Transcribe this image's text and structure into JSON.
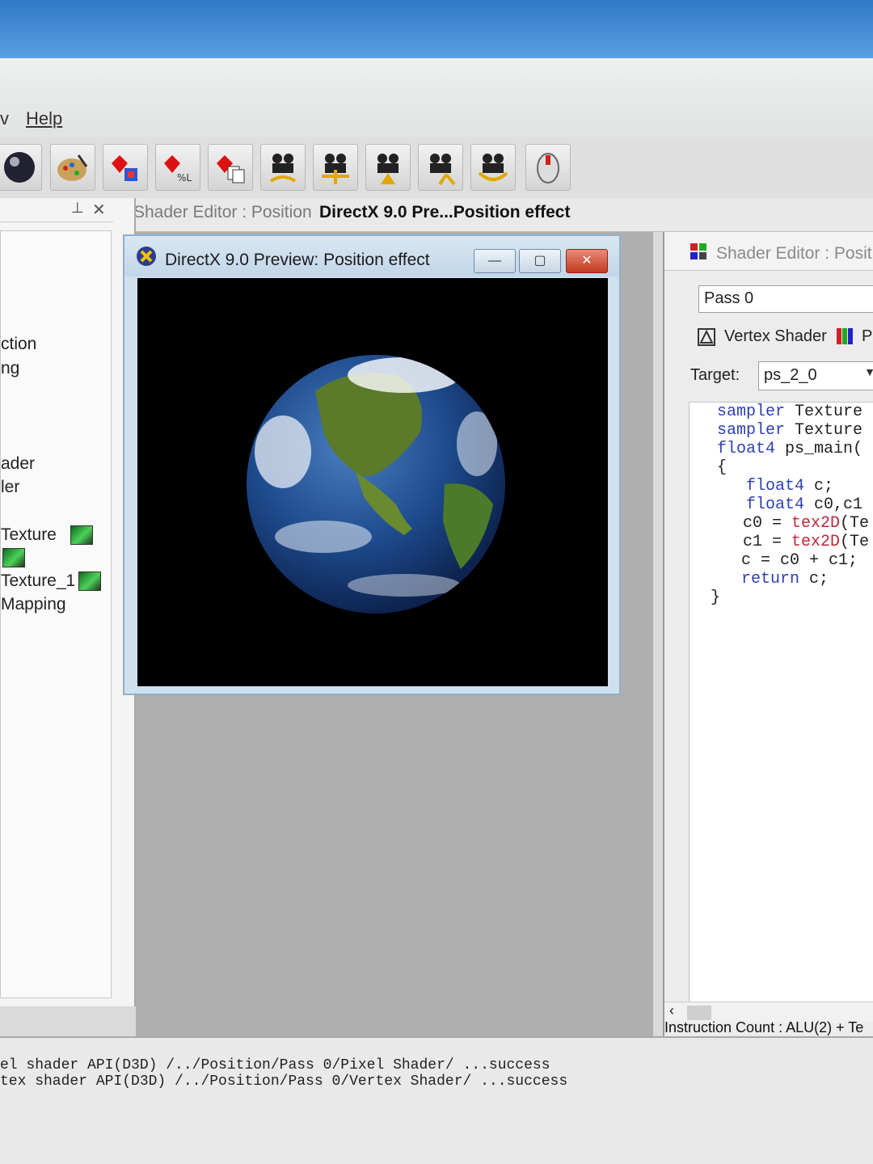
{
  "menu": {
    "partial": "v",
    "help": "Help"
  },
  "toolbar": {
    "icons": [
      "sphere-render-icon",
      "paint-palette-icon",
      "shader-color-icon",
      "shader-gl-icon",
      "shader-copy-icon",
      "camera-1-icon",
      "camera-2-icon",
      "camera-3-icon",
      "camera-4-icon",
      "camera-5-icon",
      "mouse-icon"
    ]
  },
  "tabs": {
    "shader_editor": "Shader Editor : Position",
    "preview": "DirectX 9.0 Pre...Position effect"
  },
  "left_panel": {
    "items": [
      "ction",
      "ng",
      "ader",
      "ler",
      "Texture",
      "Texture_1",
      "Mapping"
    ]
  },
  "preview_window": {
    "title": "DirectX 9.0 Preview: Position effect",
    "minimize": "—",
    "maximize": "▢",
    "close": "✕"
  },
  "right_panel": {
    "title": "Shader Editor : Positio",
    "pass": "Pass 0",
    "vertex_tab": "Vertex Shader",
    "pixel_tab": "P",
    "target_label": "Target:",
    "target_value": "ps_2_0",
    "instruction": "Instruction Count :  ALU(2) + Te"
  },
  "code": {
    "l1_kw": "sampler",
    "l1_rest": " Texture",
    "l2_kw": "sampler",
    "l2_rest": " Texture",
    "l3_kw": "float4",
    "l3_rest": " ps_main(",
    "l4": "{",
    "l5_kw": "float4",
    "l5_rest": " c;",
    "l6_kw": "float4",
    "l6_rest": " c0,c1",
    "l7_a": "c0 = ",
    "l7_fn": "tex2D",
    "l7_b": "(Te",
    "l8_a": "c1 = ",
    "l8_fn": "tex2D",
    "l8_b": "(Te",
    "l9": "c = c0 + c1;",
    "l10_kw": "return",
    "l10_rest": " c;",
    "l11": "}"
  },
  "output": {
    "line1": "el shader API(D3D) /../Position/Pass 0/Pixel Shader/ ...success",
    "line2": "tex shader API(D3D) /../Position/Pass 0/Vertex Shader/ ...success"
  }
}
